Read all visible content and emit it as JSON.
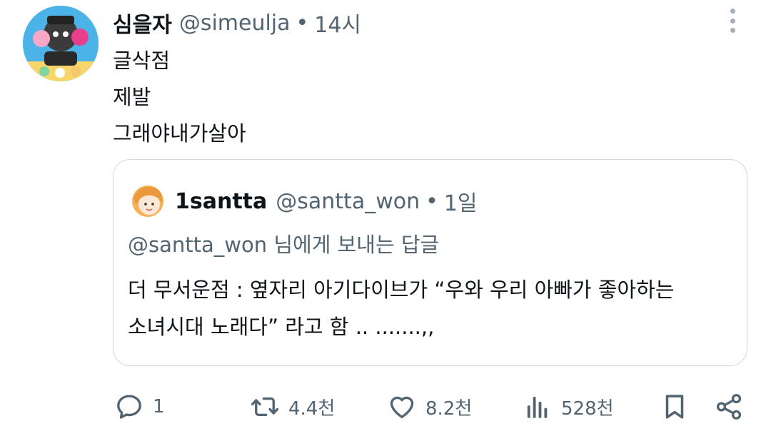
{
  "tweet": {
    "display_name": "심을자",
    "handle": "@simeulja",
    "separator": "•",
    "time": "14시",
    "lines": [
      "글삭점",
      "제발",
      "그래야내가살아"
    ]
  },
  "quoted": {
    "display_name": "1santta",
    "handle": "@santta_won",
    "separator": "•",
    "time": "1일",
    "reply_to": "@santta_won 님에게 보내는 답글",
    "text_lines": [
      "더 무서운점 : 옆자리 아기다이브가 “우와 우리 아빠가 좋아하는",
      "소녀시대 노래다” 라고 함 .. .......,,"
    ]
  },
  "actions": {
    "reply_count": "1",
    "retweet_count": "4.4천",
    "like_count": "8.2천",
    "view_count": "528천"
  },
  "icons": {
    "more": "more-vertical-icon",
    "reply": "speech-bubble-icon",
    "retweet": "retweet-arrows-icon",
    "like": "heart-icon",
    "views": "bar-chart-icon",
    "bookmark": "bookmark-icon",
    "share": "share-icon"
  },
  "colors": {
    "text": "#0f1419",
    "secondary": "#536471",
    "border": "#cfd9de",
    "avatar_bg": "#4bb3e8"
  }
}
